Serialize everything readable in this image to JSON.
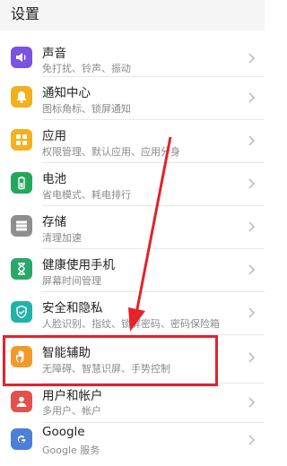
{
  "header": {
    "title": "设置"
  },
  "items": [
    {
      "id": "sound",
      "label": "声音",
      "sub": "免打扰、铃声、振动",
      "icon": "speaker-icon",
      "color": "#7c52e0"
    },
    {
      "id": "notifications",
      "label": "通知中心",
      "sub": "图标角标、锁屏通知",
      "icon": "bell-icon",
      "color": "#f2b01e"
    },
    {
      "id": "apps",
      "label": "应用",
      "sub": "权限管理、默认应用、应用分身",
      "icon": "grid-icon",
      "color": "#f4b020"
    },
    {
      "id": "battery",
      "label": "电池",
      "sub": "省电模式、耗电排行",
      "icon": "battery-icon",
      "color": "#25a75a"
    },
    {
      "id": "storage",
      "label": "存储",
      "sub": "清理加速",
      "icon": "storage-icon",
      "color": "#8e8e8e"
    },
    {
      "id": "digital-health",
      "label": "健康使用手机",
      "sub": "屏幕时间管理",
      "icon": "hourglass-icon",
      "color": "#29a86a"
    },
    {
      "id": "security",
      "label": "安全和隐私",
      "sub": "人脸识别、指纹、锁屏密码、密码保险箱",
      "icon": "shield-icon",
      "color": "#21b3a8"
    },
    {
      "id": "accessibility",
      "label": "智能辅助",
      "sub": "无障碍、智慧识屏、手势控制",
      "icon": "hand-icon",
      "color": "#f19a2a"
    },
    {
      "id": "users",
      "label": "用户和帐户",
      "sub": "多用户、帐户",
      "icon": "user-icon",
      "color": "#e3514a"
    },
    {
      "id": "google",
      "label": "Google",
      "sub": "Google 服务",
      "icon": "google-icon",
      "color": "#4d7fd8"
    }
  ]
}
